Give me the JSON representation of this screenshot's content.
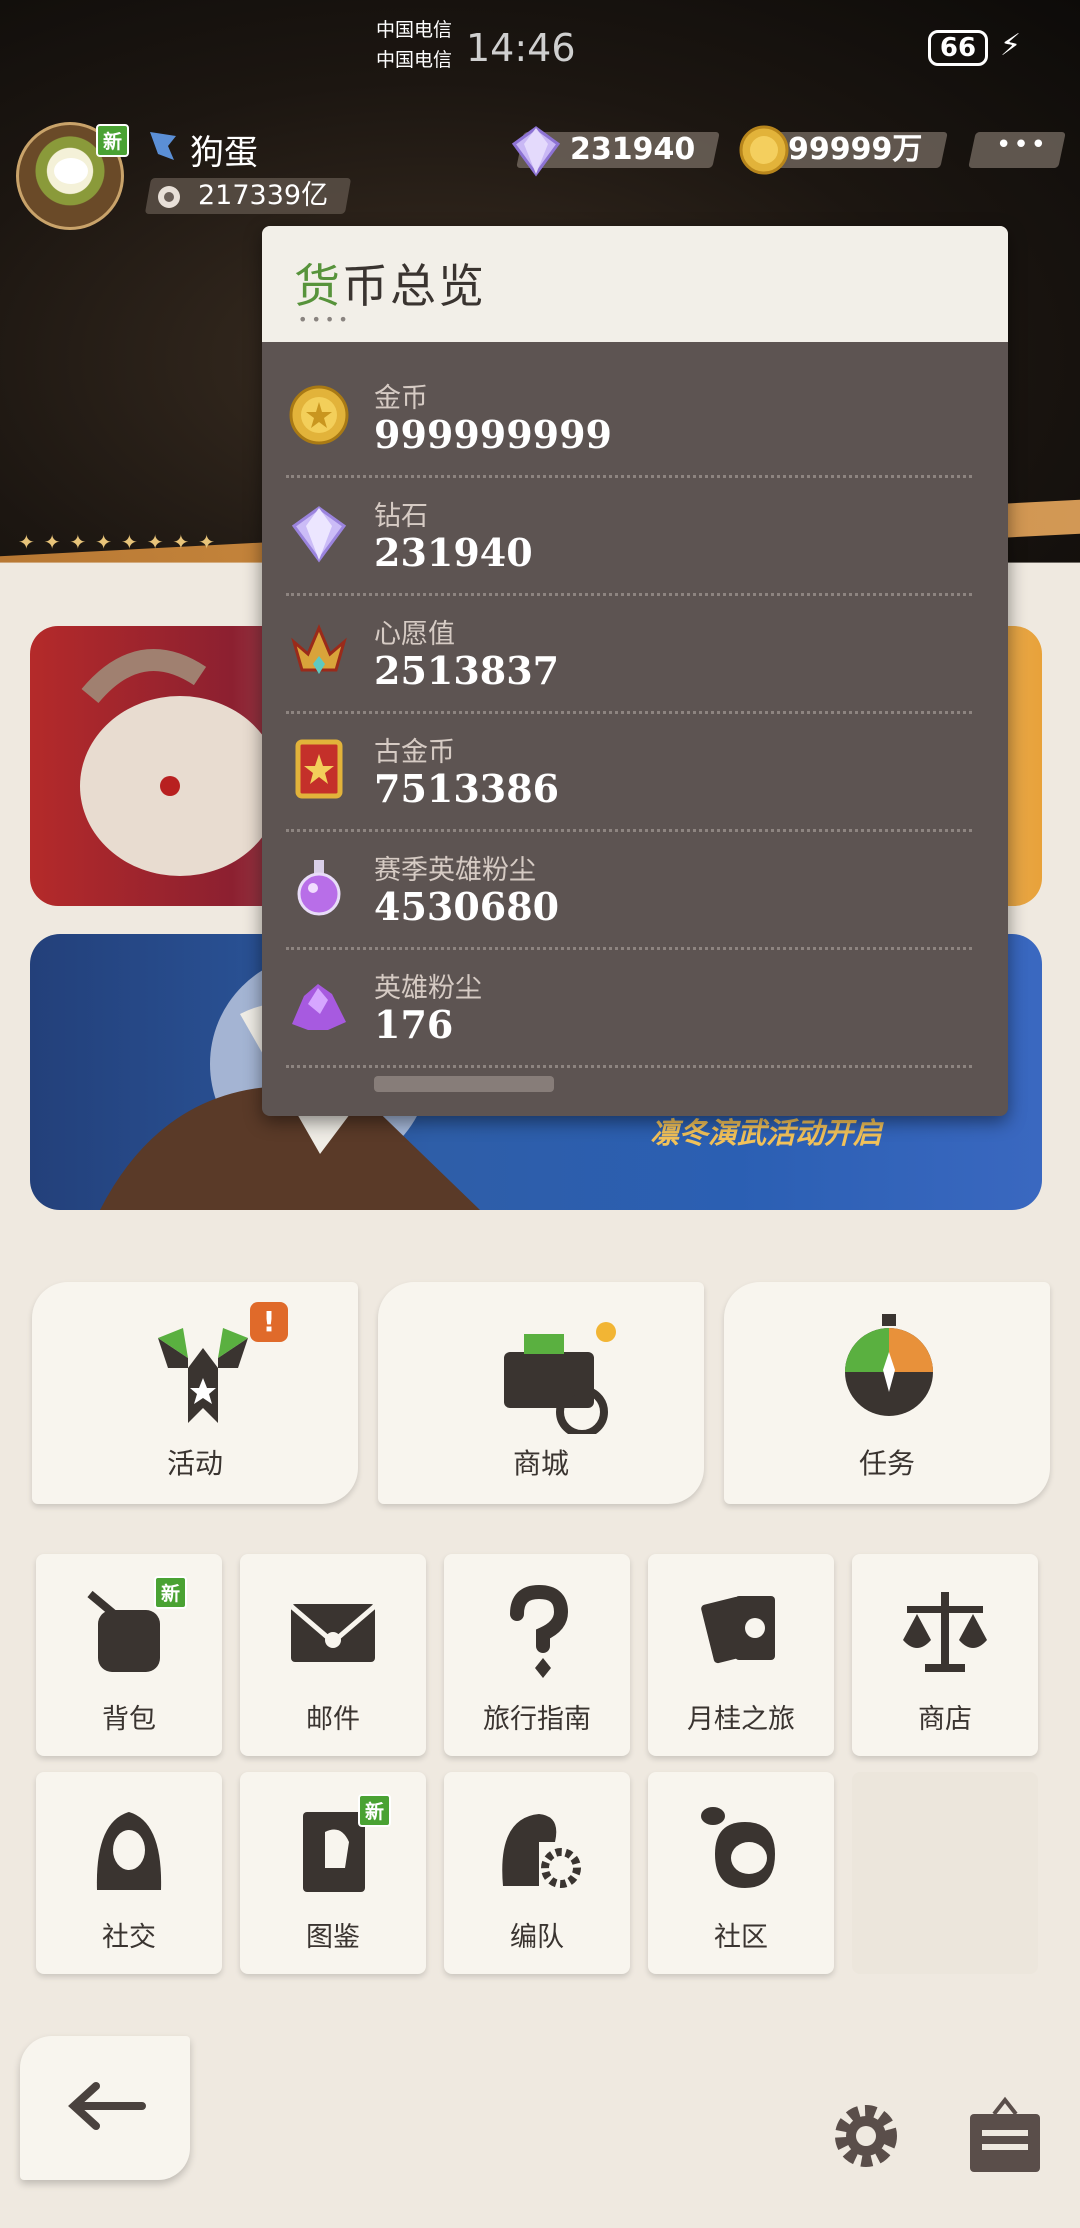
{
  "status_bar": {
    "carrier1": "中国电信",
    "carrier2": "中国电信",
    "time": "14:46",
    "battery": "66"
  },
  "player": {
    "name": "狗蛋",
    "power": "217339亿",
    "avatar_badge": "新"
  },
  "top_currency": {
    "diamond": "231940",
    "gold": "99999万"
  },
  "popup": {
    "title_first": "货",
    "title_rest": "币总览",
    "items": [
      {
        "name": "金币",
        "value": "999999999",
        "icon": "gold-coin-icon"
      },
      {
        "name": "钻石",
        "value": "231940",
        "icon": "diamond-icon"
      },
      {
        "name": "心愿值",
        "value": "2513837",
        "icon": "wish-crown-icon"
      },
      {
        "name": "古金币",
        "value": "7513386",
        "icon": "ancient-coin-icon"
      },
      {
        "name": "赛季英雄粉尘",
        "value": "4530680",
        "icon": "season-dust-potion-icon"
      },
      {
        "name": "英雄粉尘",
        "value": "176",
        "icon": "hero-dust-icon"
      }
    ]
  },
  "banner2_text": "凛冬演武活动开启",
  "menu": {
    "big": [
      {
        "label": "活动",
        "icon": "activity-flag-icon"
      },
      {
        "label": "商城",
        "icon": "mall-cart-icon"
      },
      {
        "label": "任务",
        "icon": "task-compass-icon"
      }
    ],
    "row1": [
      {
        "label": "背包",
        "icon": "backpack-icon",
        "badge": "新"
      },
      {
        "label": "邮件",
        "icon": "mail-icon"
      },
      {
        "label": "旅行指南",
        "icon": "guide-question-icon"
      },
      {
        "label": "月桂之旅",
        "icon": "cards-icon"
      },
      {
        "label": "商店",
        "icon": "scale-shop-icon"
      }
    ],
    "row2": [
      {
        "label": "社交",
        "icon": "social-hood-icon"
      },
      {
        "label": "图鉴",
        "icon": "codex-book-icon",
        "badge": "新"
      },
      {
        "label": "编队",
        "icon": "team-helmet-icon"
      },
      {
        "label": "社区",
        "icon": "community-icon"
      }
    ]
  },
  "colors": {
    "accent_green": "#57933b",
    "popup_body": "#5d5452",
    "card_bg": "#f8f5ee"
  }
}
